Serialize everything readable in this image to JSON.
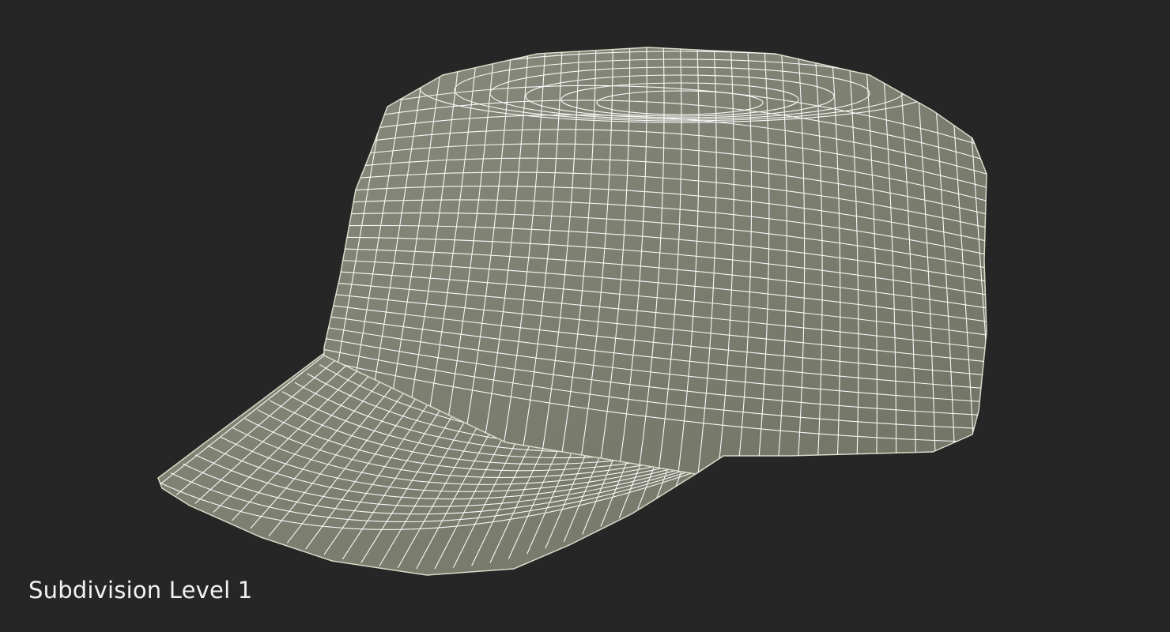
{
  "caption": "Subdivision Level 1",
  "colors": {
    "background": "#262626",
    "surface": "#7a7c6e",
    "wireframe": "#ffffff",
    "caption_text": "#f2f2f2"
  }
}
